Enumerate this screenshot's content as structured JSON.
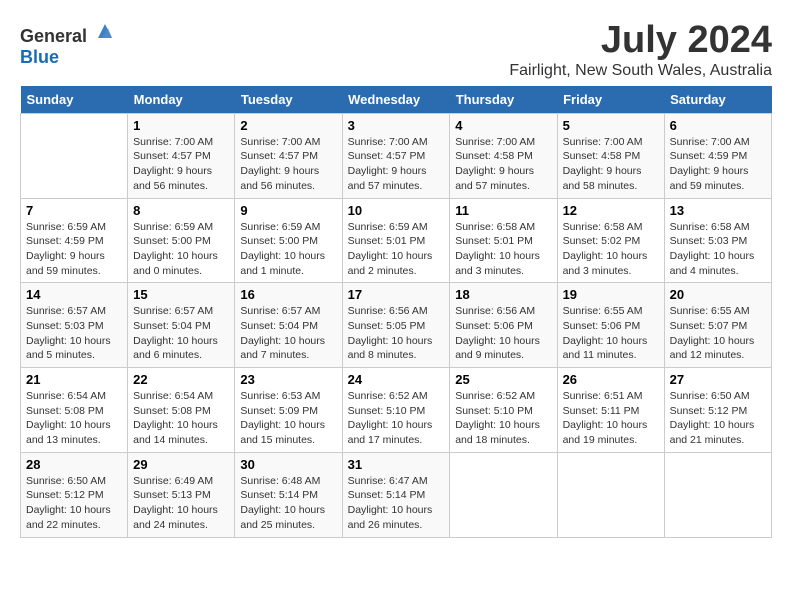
{
  "header": {
    "logo_general": "General",
    "logo_blue": "Blue",
    "month_year": "July 2024",
    "location": "Fairlight, New South Wales, Australia"
  },
  "weekdays": [
    "Sunday",
    "Monday",
    "Tuesday",
    "Wednesday",
    "Thursday",
    "Friday",
    "Saturday"
  ],
  "weeks": [
    [
      {
        "day": "",
        "sunrise": "",
        "sunset": "",
        "daylight": ""
      },
      {
        "day": "1",
        "sunrise": "Sunrise: 7:00 AM",
        "sunset": "Sunset: 4:57 PM",
        "daylight": "Daylight: 9 hours and 56 minutes."
      },
      {
        "day": "2",
        "sunrise": "Sunrise: 7:00 AM",
        "sunset": "Sunset: 4:57 PM",
        "daylight": "Daylight: 9 hours and 56 minutes."
      },
      {
        "day": "3",
        "sunrise": "Sunrise: 7:00 AM",
        "sunset": "Sunset: 4:57 PM",
        "daylight": "Daylight: 9 hours and 57 minutes."
      },
      {
        "day": "4",
        "sunrise": "Sunrise: 7:00 AM",
        "sunset": "Sunset: 4:58 PM",
        "daylight": "Daylight: 9 hours and 57 minutes."
      },
      {
        "day": "5",
        "sunrise": "Sunrise: 7:00 AM",
        "sunset": "Sunset: 4:58 PM",
        "daylight": "Daylight: 9 hours and 58 minutes."
      },
      {
        "day": "6",
        "sunrise": "Sunrise: 7:00 AM",
        "sunset": "Sunset: 4:59 PM",
        "daylight": "Daylight: 9 hours and 59 minutes."
      }
    ],
    [
      {
        "day": "7",
        "sunrise": "Sunrise: 6:59 AM",
        "sunset": "Sunset: 4:59 PM",
        "daylight": "Daylight: 9 hours and 59 minutes."
      },
      {
        "day": "8",
        "sunrise": "Sunrise: 6:59 AM",
        "sunset": "Sunset: 5:00 PM",
        "daylight": "Daylight: 10 hours and 0 minutes."
      },
      {
        "day": "9",
        "sunrise": "Sunrise: 6:59 AM",
        "sunset": "Sunset: 5:00 PM",
        "daylight": "Daylight: 10 hours and 1 minute."
      },
      {
        "day": "10",
        "sunrise": "Sunrise: 6:59 AM",
        "sunset": "Sunset: 5:01 PM",
        "daylight": "Daylight: 10 hours and 2 minutes."
      },
      {
        "day": "11",
        "sunrise": "Sunrise: 6:58 AM",
        "sunset": "Sunset: 5:01 PM",
        "daylight": "Daylight: 10 hours and 3 minutes."
      },
      {
        "day": "12",
        "sunrise": "Sunrise: 6:58 AM",
        "sunset": "Sunset: 5:02 PM",
        "daylight": "Daylight: 10 hours and 3 minutes."
      },
      {
        "day": "13",
        "sunrise": "Sunrise: 6:58 AM",
        "sunset": "Sunset: 5:03 PM",
        "daylight": "Daylight: 10 hours and 4 minutes."
      }
    ],
    [
      {
        "day": "14",
        "sunrise": "Sunrise: 6:57 AM",
        "sunset": "Sunset: 5:03 PM",
        "daylight": "Daylight: 10 hours and 5 minutes."
      },
      {
        "day": "15",
        "sunrise": "Sunrise: 6:57 AM",
        "sunset": "Sunset: 5:04 PM",
        "daylight": "Daylight: 10 hours and 6 minutes."
      },
      {
        "day": "16",
        "sunrise": "Sunrise: 6:57 AM",
        "sunset": "Sunset: 5:04 PM",
        "daylight": "Daylight: 10 hours and 7 minutes."
      },
      {
        "day": "17",
        "sunrise": "Sunrise: 6:56 AM",
        "sunset": "Sunset: 5:05 PM",
        "daylight": "Daylight: 10 hours and 8 minutes."
      },
      {
        "day": "18",
        "sunrise": "Sunrise: 6:56 AM",
        "sunset": "Sunset: 5:06 PM",
        "daylight": "Daylight: 10 hours and 9 minutes."
      },
      {
        "day": "19",
        "sunrise": "Sunrise: 6:55 AM",
        "sunset": "Sunset: 5:06 PM",
        "daylight": "Daylight: 10 hours and 11 minutes."
      },
      {
        "day": "20",
        "sunrise": "Sunrise: 6:55 AM",
        "sunset": "Sunset: 5:07 PM",
        "daylight": "Daylight: 10 hours and 12 minutes."
      }
    ],
    [
      {
        "day": "21",
        "sunrise": "Sunrise: 6:54 AM",
        "sunset": "Sunset: 5:08 PM",
        "daylight": "Daylight: 10 hours and 13 minutes."
      },
      {
        "day": "22",
        "sunrise": "Sunrise: 6:54 AM",
        "sunset": "Sunset: 5:08 PM",
        "daylight": "Daylight: 10 hours and 14 minutes."
      },
      {
        "day": "23",
        "sunrise": "Sunrise: 6:53 AM",
        "sunset": "Sunset: 5:09 PM",
        "daylight": "Daylight: 10 hours and 15 minutes."
      },
      {
        "day": "24",
        "sunrise": "Sunrise: 6:52 AM",
        "sunset": "Sunset: 5:10 PM",
        "daylight": "Daylight: 10 hours and 17 minutes."
      },
      {
        "day": "25",
        "sunrise": "Sunrise: 6:52 AM",
        "sunset": "Sunset: 5:10 PM",
        "daylight": "Daylight: 10 hours and 18 minutes."
      },
      {
        "day": "26",
        "sunrise": "Sunrise: 6:51 AM",
        "sunset": "Sunset: 5:11 PM",
        "daylight": "Daylight: 10 hours and 19 minutes."
      },
      {
        "day": "27",
        "sunrise": "Sunrise: 6:50 AM",
        "sunset": "Sunset: 5:12 PM",
        "daylight": "Daylight: 10 hours and 21 minutes."
      }
    ],
    [
      {
        "day": "28",
        "sunrise": "Sunrise: 6:50 AM",
        "sunset": "Sunset: 5:12 PM",
        "daylight": "Daylight: 10 hours and 22 minutes."
      },
      {
        "day": "29",
        "sunrise": "Sunrise: 6:49 AM",
        "sunset": "Sunset: 5:13 PM",
        "daylight": "Daylight: 10 hours and 24 minutes."
      },
      {
        "day": "30",
        "sunrise": "Sunrise: 6:48 AM",
        "sunset": "Sunset: 5:14 PM",
        "daylight": "Daylight: 10 hours and 25 minutes."
      },
      {
        "day": "31",
        "sunrise": "Sunrise: 6:47 AM",
        "sunset": "Sunset: 5:14 PM",
        "daylight": "Daylight: 10 hours and 26 minutes."
      },
      {
        "day": "",
        "sunrise": "",
        "sunset": "",
        "daylight": ""
      },
      {
        "day": "",
        "sunrise": "",
        "sunset": "",
        "daylight": ""
      },
      {
        "day": "",
        "sunrise": "",
        "sunset": "",
        "daylight": ""
      }
    ]
  ]
}
